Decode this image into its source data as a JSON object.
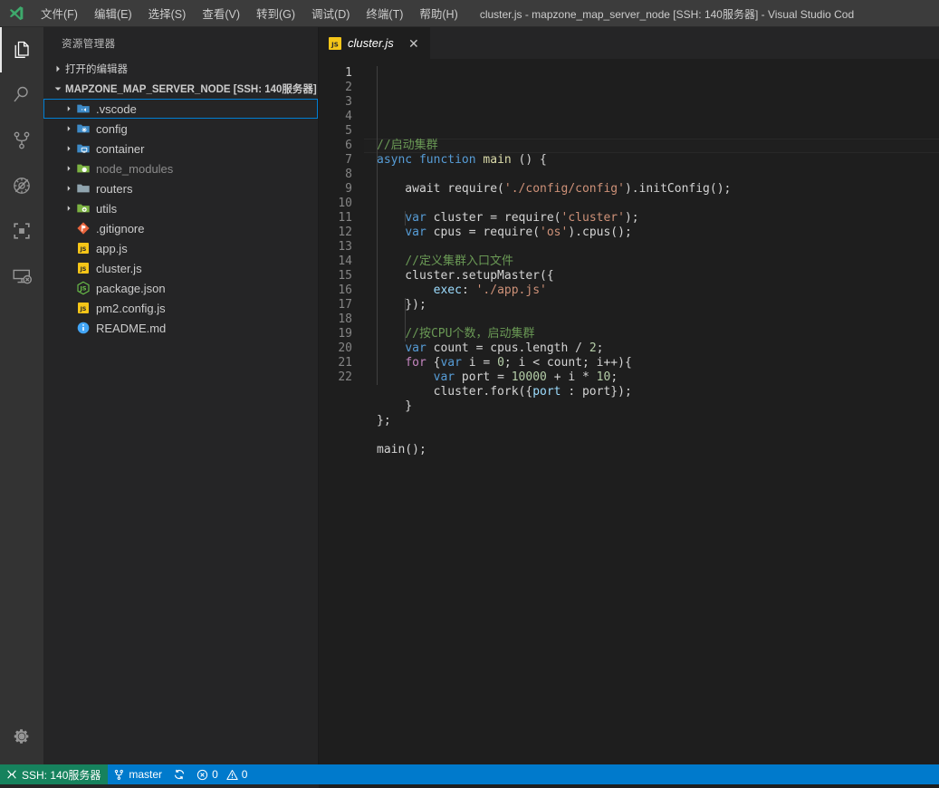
{
  "titlebar": {
    "window_title": "cluster.js - mapzone_map_server_node [SSH: 140服务器] - Visual Studio Cod",
    "logo_icon": "vscode-logo-icon",
    "menus": [
      {
        "label": "文件(F)"
      },
      {
        "label": "编辑(E)"
      },
      {
        "label": "选择(S)"
      },
      {
        "label": "查看(V)"
      },
      {
        "label": "转到(G)"
      },
      {
        "label": "调试(D)"
      },
      {
        "label": "终端(T)"
      },
      {
        "label": "帮助(H)"
      }
    ]
  },
  "activitybar": {
    "items": [
      {
        "name": "explorer",
        "icon": "files-icon",
        "active": true
      },
      {
        "name": "search",
        "icon": "search-icon",
        "active": false
      },
      {
        "name": "source-control",
        "icon": "source-control-icon",
        "active": false
      },
      {
        "name": "run-debug",
        "icon": "debug-icon",
        "active": false
      },
      {
        "name": "extensions",
        "icon": "extensions-icon",
        "active": false
      },
      {
        "name": "remote-explorer",
        "icon": "remote-explorer-icon",
        "active": false
      }
    ],
    "bottom": [
      {
        "name": "manage",
        "icon": "gear-icon"
      }
    ]
  },
  "sidebar": {
    "title": "资源管理器",
    "open_editors": {
      "label": "打开的编辑器",
      "expanded": false
    },
    "root_folder": {
      "label": "MAPZONE_MAP_SERVER_NODE [SSH: 140服务器]",
      "expanded": true
    },
    "tree": [
      {
        "label": ".vscode",
        "kind": "folder",
        "icon": "folder-vscode-icon",
        "color": "#3d8ac7",
        "expanded": false,
        "focused": true,
        "dim": false
      },
      {
        "label": "config",
        "kind": "folder",
        "icon": "folder-config-icon",
        "color": "#3d8ac7",
        "expanded": false,
        "focused": false,
        "dim": false
      },
      {
        "label": "container",
        "kind": "folder",
        "icon": "folder-container-icon",
        "color": "#3d8ac7",
        "expanded": false,
        "focused": false,
        "dim": false
      },
      {
        "label": "node_modules",
        "kind": "folder",
        "icon": "folder-node-icon",
        "color": "#7cb342",
        "expanded": false,
        "focused": false,
        "dim": true
      },
      {
        "label": "routers",
        "kind": "folder",
        "icon": "folder-icon",
        "color": "#90a4ae",
        "expanded": false,
        "focused": false,
        "dim": false
      },
      {
        "label": "utils",
        "kind": "folder",
        "icon": "folder-utils-icon",
        "color": "#7cb342",
        "expanded": false,
        "focused": false,
        "dim": false
      },
      {
        "label": ".gitignore",
        "kind": "file",
        "icon": "git-icon",
        "color": "#e8643c",
        "expanded": null,
        "focused": false,
        "dim": false
      },
      {
        "label": "app.js",
        "kind": "file",
        "icon": "javascript-icon",
        "color": "#f5c518",
        "expanded": null,
        "focused": false,
        "dim": false
      },
      {
        "label": "cluster.js",
        "kind": "file",
        "icon": "javascript-icon",
        "color": "#f5c518",
        "expanded": null,
        "focused": false,
        "dim": false
      },
      {
        "label": "package.json",
        "kind": "file",
        "icon": "nodejs-icon",
        "color": "#6cc24a",
        "expanded": null,
        "focused": false,
        "dim": false
      },
      {
        "label": "pm2.config.js",
        "kind": "file",
        "icon": "javascript-icon",
        "color": "#f5c518",
        "expanded": null,
        "focused": false,
        "dim": false
      },
      {
        "label": "README.md",
        "kind": "file",
        "icon": "info-icon",
        "color": "#42a5f5",
        "expanded": null,
        "focused": false,
        "dim": false
      }
    ]
  },
  "editor": {
    "tabs": [
      {
        "label": "cluster.js",
        "icon": "javascript-icon",
        "active": true,
        "preview": true,
        "close_icon": "close-icon",
        "close_label": "✕"
      }
    ],
    "active_line": 1,
    "total_lines": 22,
    "line_numbers": [
      "1",
      "2",
      "3",
      "4",
      "5",
      "6",
      "7",
      "8",
      "9",
      "10",
      "11",
      "12",
      "13",
      "14",
      "15",
      "16",
      "17",
      "18",
      "19",
      "20",
      "21",
      "22"
    ],
    "lines": [
      {
        "n": 1,
        "tokens": [
          {
            "t": "//启动集群",
            "c": "t-cmt"
          }
        ]
      },
      {
        "n": 2,
        "tokens": [
          {
            "t": "async",
            "c": "t-kw"
          },
          {
            "t": " ",
            "c": "t-pln"
          },
          {
            "t": "function",
            "c": "t-kw"
          },
          {
            "t": " ",
            "c": "t-pln"
          },
          {
            "t": "main",
            "c": "t-fn"
          },
          {
            "t": " () {",
            "c": "t-pln"
          }
        ]
      },
      {
        "n": 3,
        "tokens": []
      },
      {
        "n": 4,
        "tokens": [
          {
            "t": "    await require(",
            "c": "t-pln"
          },
          {
            "t": "'./config/config'",
            "c": "t-str"
          },
          {
            "t": ").initConfig();",
            "c": "t-pln"
          }
        ]
      },
      {
        "n": 5,
        "tokens": []
      },
      {
        "n": 6,
        "tokens": [
          {
            "t": "    ",
            "c": "t-pln"
          },
          {
            "t": "var",
            "c": "t-kw"
          },
          {
            "t": " cluster = require(",
            "c": "t-pln"
          },
          {
            "t": "'cluster'",
            "c": "t-str"
          },
          {
            "t": ");",
            "c": "t-pln"
          }
        ]
      },
      {
        "n": 7,
        "tokens": [
          {
            "t": "    ",
            "c": "t-pln"
          },
          {
            "t": "var",
            "c": "t-kw"
          },
          {
            "t": " cpus = require(",
            "c": "t-pln"
          },
          {
            "t": "'os'",
            "c": "t-str"
          },
          {
            "t": ").cpus();",
            "c": "t-pln"
          }
        ]
      },
      {
        "n": 8,
        "tokens": []
      },
      {
        "n": 9,
        "tokens": [
          {
            "t": "    ",
            "c": "t-pln"
          },
          {
            "t": "//定义集群入口文件",
            "c": "t-cmt"
          }
        ]
      },
      {
        "n": 10,
        "tokens": [
          {
            "t": "    cluster.setupMaster({",
            "c": "t-pln"
          }
        ]
      },
      {
        "n": 11,
        "tokens": [
          {
            "t": "        ",
            "c": "t-pln"
          },
          {
            "t": "exec",
            "c": "t-var"
          },
          {
            "t": ": ",
            "c": "t-pln"
          },
          {
            "t": "'./app.js'",
            "c": "t-str"
          }
        ]
      },
      {
        "n": 12,
        "tokens": [
          {
            "t": "    });",
            "c": "t-pln"
          }
        ]
      },
      {
        "n": 13,
        "tokens": []
      },
      {
        "n": 14,
        "tokens": [
          {
            "t": "    ",
            "c": "t-pln"
          },
          {
            "t": "//按CPU个数，启动集群",
            "c": "t-cmt"
          }
        ]
      },
      {
        "n": 15,
        "tokens": [
          {
            "t": "    ",
            "c": "t-pln"
          },
          {
            "t": "var",
            "c": "t-kw"
          },
          {
            "t": " count = cpus.length / ",
            "c": "t-pln"
          },
          {
            "t": "2",
            "c": "t-num"
          },
          {
            "t": ";",
            "c": "t-pln"
          }
        ]
      },
      {
        "n": 16,
        "tokens": [
          {
            "t": "    ",
            "c": "t-pln"
          },
          {
            "t": "for",
            "c": "t-ctl"
          },
          {
            "t": " {",
            "c": "t-pln"
          },
          {
            "t": "var",
            "c": "t-kw"
          },
          {
            "t": " i = ",
            "c": "t-pln"
          },
          {
            "t": "0",
            "c": "t-num"
          },
          {
            "t": "; i < count; i++){",
            "c": "t-pln"
          }
        ]
      },
      {
        "n": 17,
        "tokens": [
          {
            "t": "        ",
            "c": "t-pln"
          },
          {
            "t": "var",
            "c": "t-kw"
          },
          {
            "t": " port = ",
            "c": "t-pln"
          },
          {
            "t": "10000",
            "c": "t-num"
          },
          {
            "t": " + i * ",
            "c": "t-pln"
          },
          {
            "t": "10",
            "c": "t-num"
          },
          {
            "t": ";",
            "c": "t-pln"
          }
        ]
      },
      {
        "n": 18,
        "tokens": [
          {
            "t": "        cluster.fork({",
            "c": "t-pln"
          },
          {
            "t": "port",
            "c": "t-var"
          },
          {
            "t": " : port});",
            "c": "t-pln"
          }
        ]
      },
      {
        "n": 19,
        "tokens": [
          {
            "t": "    }",
            "c": "t-pln"
          }
        ]
      },
      {
        "n": 20,
        "tokens": [
          {
            "t": "};",
            "c": "t-pln"
          }
        ]
      },
      {
        "n": 21,
        "tokens": []
      },
      {
        "n": 22,
        "tokens": [
          {
            "t": "main();",
            "c": "t-pln"
          }
        ]
      }
    ]
  },
  "statusbar": {
    "remote": {
      "label": "SSH: 140服务器",
      "icon": "remote-indicator-icon",
      "bg": "#16825d"
    },
    "branch": {
      "label": "master",
      "icon": "source-control-icon"
    },
    "sync": {
      "label": "",
      "icon": "sync-icon"
    },
    "problems": {
      "errors": "0",
      "warnings": "0",
      "error_icon": "error-icon",
      "warning_icon": "warning-icon"
    },
    "background": "#007acc"
  }
}
